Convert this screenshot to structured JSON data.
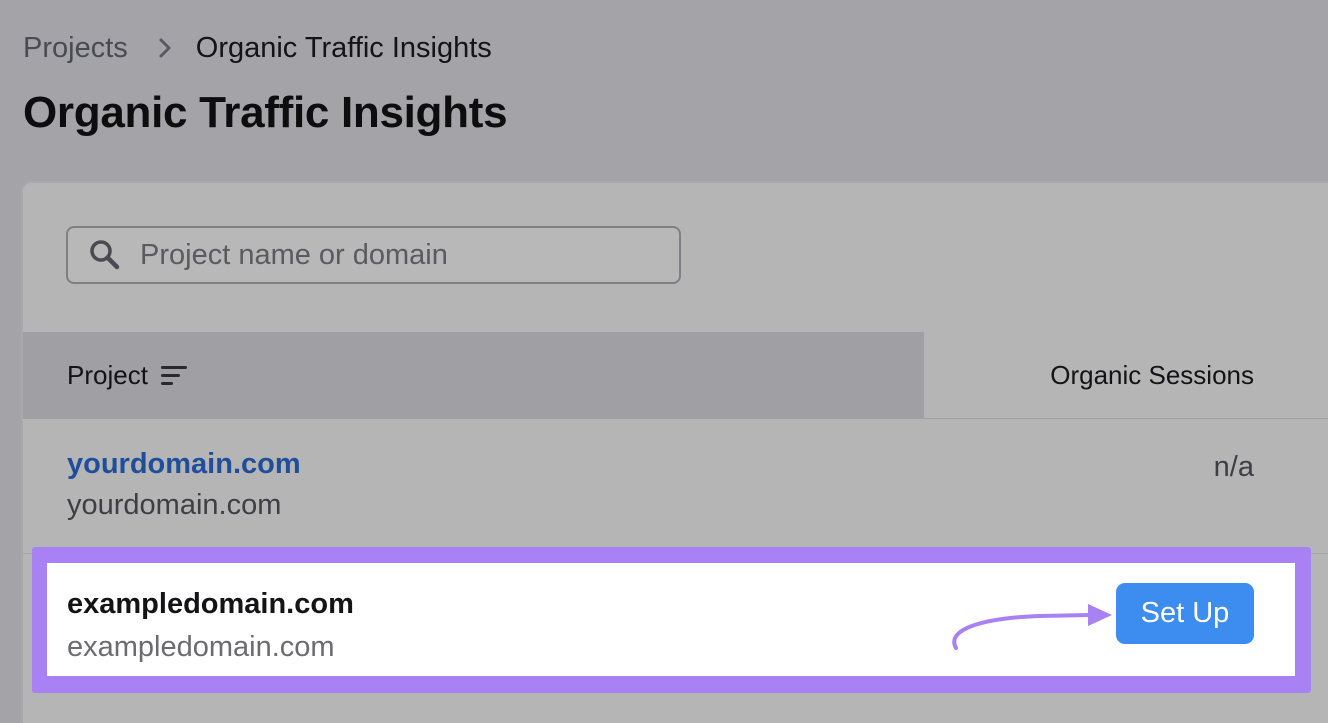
{
  "breadcrumb": {
    "parent": "Projects",
    "current": "Organic Traffic Insights"
  },
  "page": {
    "title": "Organic Traffic Insights"
  },
  "search": {
    "placeholder": "Project name or domain",
    "value": ""
  },
  "table": {
    "columns": {
      "project": "Project",
      "sessions": "Organic Sessions"
    },
    "rows": [
      {
        "name": "yourdomain.com",
        "domain": "yourdomain.com",
        "sessions": "n/a"
      },
      {
        "name": "exampledomain.com",
        "domain": "exampledomain.com",
        "action": "Set Up"
      }
    ]
  },
  "colors": {
    "link": "#1f4f9a",
    "highlight": "#a882f5",
    "button": "#3d8cf0",
    "overlay": "#a4a4a8"
  },
  "icons": [
    "chevron-right-icon",
    "search-icon",
    "sort-icon",
    "arrow-annotation-icon"
  ]
}
